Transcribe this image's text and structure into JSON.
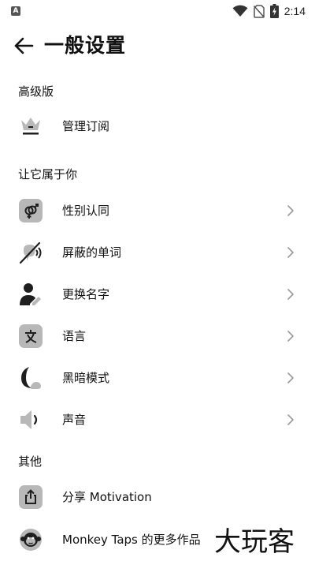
{
  "status_bar": {
    "left_icon": "A",
    "icons": [
      "wifi-icon",
      "no-sim-icon",
      "battery-charging-icon"
    ],
    "time": "2:14"
  },
  "app_bar": {
    "back_icon": "arrow-left-icon",
    "title": "一般设置"
  },
  "sections": {
    "premium": {
      "header": "高级版",
      "items": [
        {
          "label": "管理订阅",
          "icon": "crown-icon"
        }
      ]
    },
    "personal": {
      "header": "让它属于你",
      "items": [
        {
          "label": "性别认同",
          "icon": "gender-icon"
        },
        {
          "label": "屏蔽的单词",
          "icon": "muted-speech-icon"
        },
        {
          "label": "更换名字",
          "icon": "person-edit-icon"
        },
        {
          "label": "语言",
          "icon": "language-icon"
        },
        {
          "label": "黑暗模式",
          "icon": "dark-mode-icon"
        },
        {
          "label": "声音",
          "icon": "speaker-icon"
        }
      ]
    },
    "other": {
      "header": "其他",
      "items": [
        {
          "label": "分享 Motivation",
          "icon": "share-icon"
        },
        {
          "label": "Monkey Taps 的更多作品",
          "icon": "monkey-icon"
        }
      ]
    }
  },
  "watermark": {
    "text": "大玩客"
  },
  "colors": {
    "background": "#ffffff",
    "text": "#111111",
    "icon_gray": "#b8b8b8",
    "icon_dark": "#1e1e1e",
    "chevron": "#9a9a9a"
  }
}
